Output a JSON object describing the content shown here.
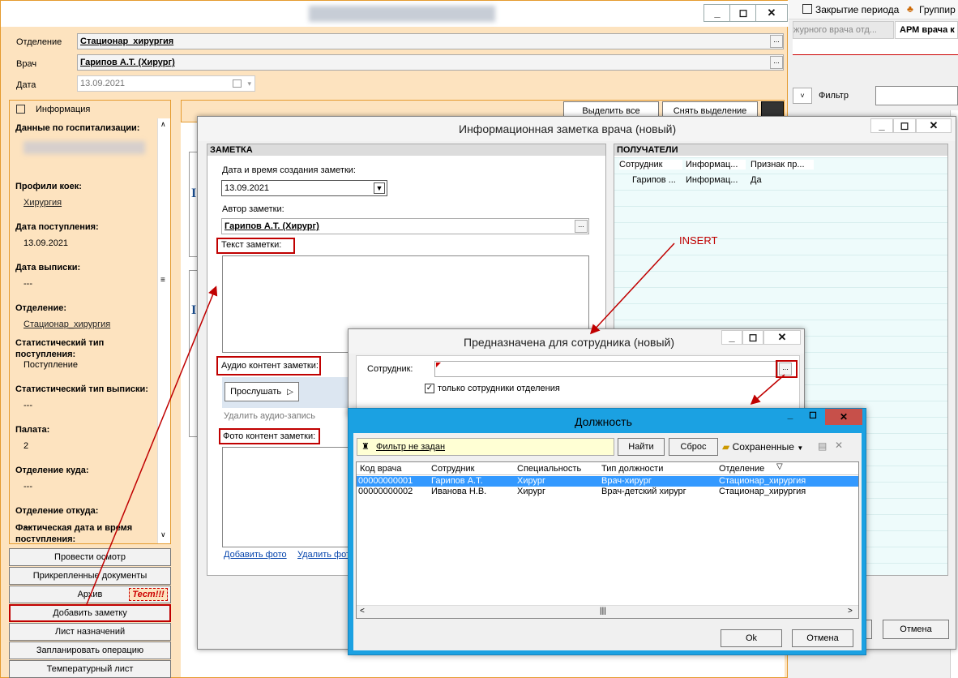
{
  "main_window": {
    "title": "",
    "form": {
      "department_label": "Отделение",
      "department_value": "Стационар_хирургия",
      "doctor_label": "Врач",
      "doctor_value": "Гарипов А.Т. (Хирург)",
      "date_label": "Дата",
      "date_value": "13.09.2021"
    },
    "info_panel": {
      "header": "Информация",
      "items": [
        {
          "label": "Данные по госпитализации:",
          "value": ""
        },
        {
          "label": "Профили коек:",
          "value": "Хирургия",
          "link": true
        },
        {
          "label": "Дата поступления:",
          "value": "13.09.2021"
        },
        {
          "label": "Дата выписки:",
          "value": "---"
        },
        {
          "label": "Отделение:",
          "value": "Стационар_хирургия",
          "link": true
        },
        {
          "label": "Статистический тип поступления:",
          "value": "Поступление"
        },
        {
          "label": "Статистический тип выписки:",
          "value": "---"
        },
        {
          "label": "Палата:",
          "value": "2"
        },
        {
          "label": "Отделение куда:",
          "value": "---"
        },
        {
          "label": "Отделение откуда:",
          "value": "---"
        },
        {
          "label": "Фактическая дата и время поступления:",
          "value": ""
        }
      ]
    },
    "select_all": "Выделить все",
    "deselect": "Снять выделение",
    "left_buttons": [
      "Провести осмотр",
      "Прикрепленные документы",
      "Архив",
      "Добавить заметку",
      "Лист назначений",
      "Запланировать операцию",
      "Температурный лист"
    ],
    "test_badge": "Тест!!!"
  },
  "background_app": {
    "toolbar": [
      "Закрытие периода",
      "Группир"
    ],
    "tabs": [
      "журного врача отд...",
      "АРМ врача к"
    ],
    "filter_label": "Фильтр"
  },
  "note_window": {
    "title": "Информационная заметка врача (новый)",
    "section_note": "ЗАМЕТКА",
    "section_recipients": "ПОЛУЧАТЕЛИ",
    "created_label": "Дата и время создания заметки:",
    "created_value": "13.09.2021",
    "author_label": "Автор заметки:",
    "author_value": "Гарипов А.Т. (Хирург)",
    "text_label": "Текст заметки:",
    "audio_label": "Аудио контент заметки:",
    "listen_button": "Прослушать",
    "delete_audio": "Удалить аудио-запись",
    "photo_label": "Фото контент заметки:",
    "add_photo": "Добавить фото",
    "delete_photo": "Удалить фот",
    "recipients_columns": [
      "Сотрудник",
      "Информац...",
      "Признак пр..."
    ],
    "recipients_rows": [
      [
        "Гарипов ...",
        "Информац...",
        "Да"
      ]
    ],
    "cancel_button": "Отмена"
  },
  "annotation": {
    "insert": "INSERT"
  },
  "employee_window": {
    "title": "Предназначена для сотрудника (новый)",
    "employee_label": "Сотрудник:",
    "only_dept_label": "только сотрудники отделения"
  },
  "position_window": {
    "title": "Должность",
    "filter_text": "Фильтр не задан",
    "find_button": "Найти",
    "reset_button": "Сброс",
    "saved_button": "Сохраненные",
    "columns": [
      "Код врача",
      "Сотрудник",
      "Специальность",
      "Тип должности",
      "Отделение"
    ],
    "rows": [
      [
        "00000000001",
        "Гарипов А.Т.",
        "Хирург",
        "Врач-хирург",
        "Стационар_хирургия"
      ],
      [
        "00000000002",
        "Иванова Н.В.",
        "Хирург",
        "Врач-детский хирург",
        "Стационар_хирургия"
      ]
    ],
    "ok_button": "Ok",
    "cancel_button": "Отмена"
  },
  "colors": {
    "accent_red": "#c00000",
    "peach": "#fde3bf",
    "selection": "#3399ff",
    "dialog_title_blue": "#1ba1e2"
  }
}
